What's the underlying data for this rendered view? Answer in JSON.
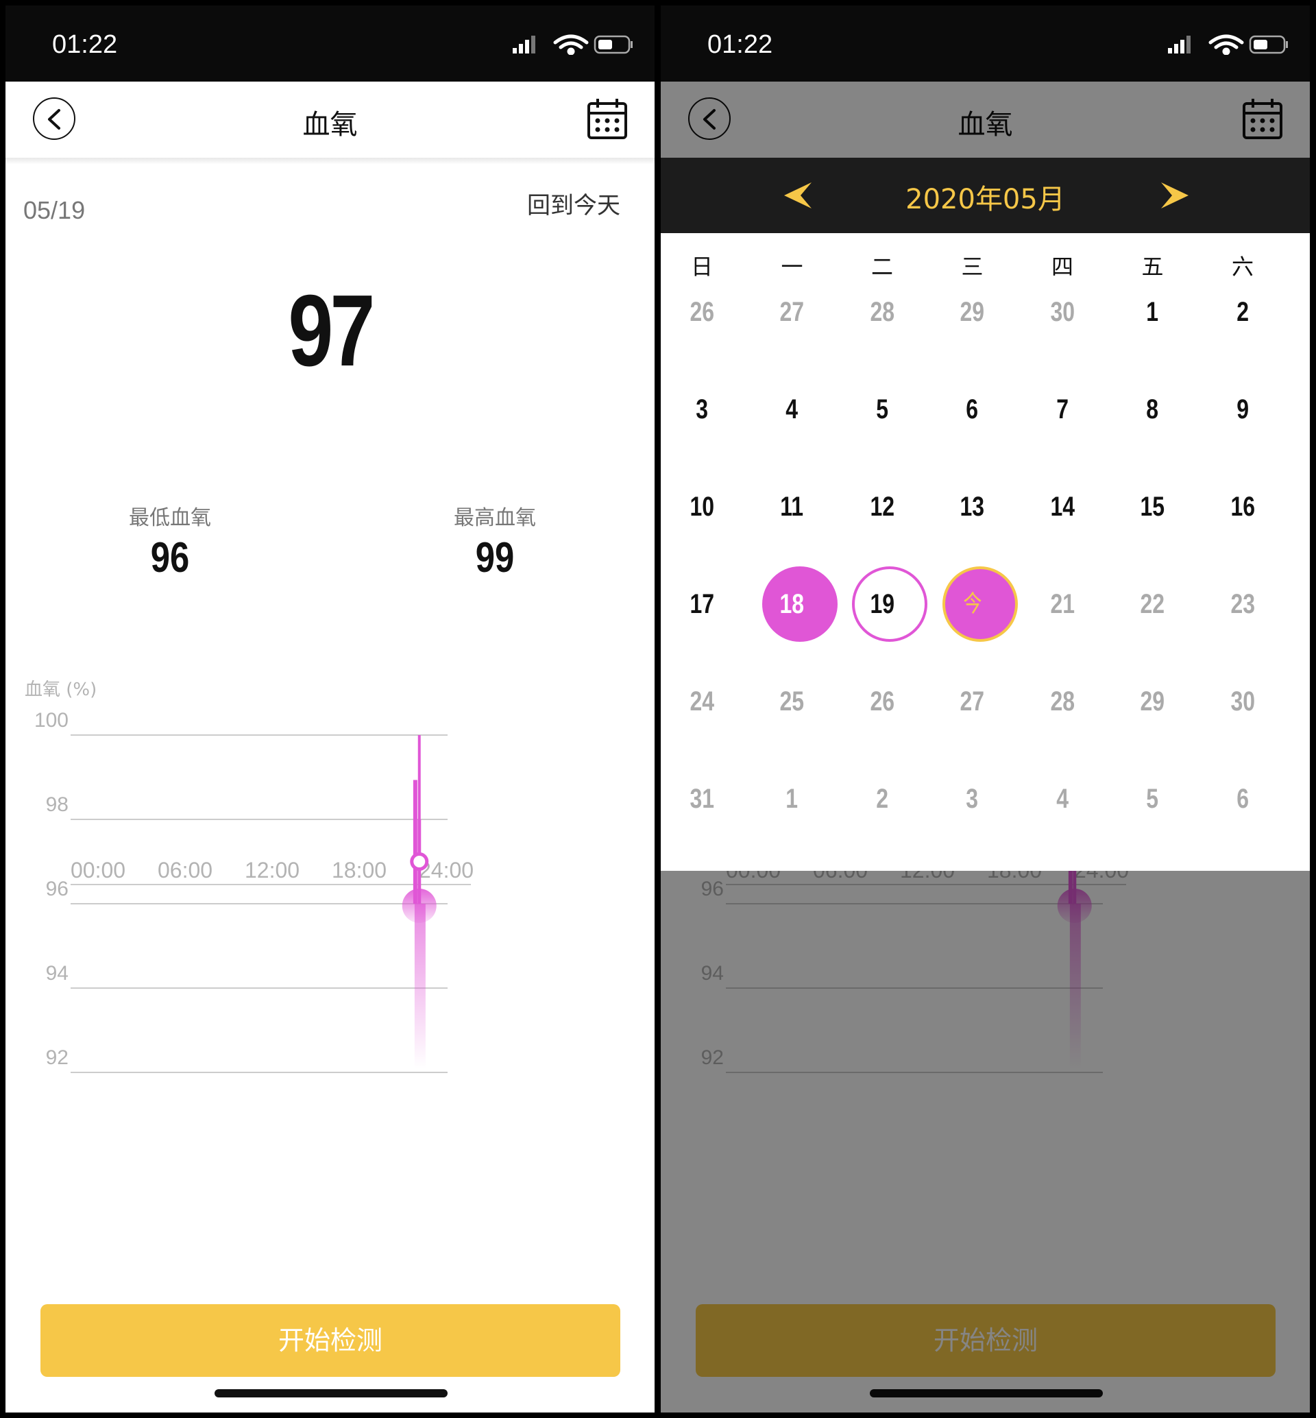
{
  "status": {
    "time": "01:22"
  },
  "nav": {
    "title": "血氧"
  },
  "summary": {
    "date": "05/19",
    "back_to_today": "回到今天",
    "current_value": "97",
    "min_label": "最低血氧",
    "min_value": "96",
    "max_label": "最高血氧",
    "max_value": "99"
  },
  "chart_data": {
    "type": "line",
    "ylabel": "血氧 (%)",
    "y_ticks": [
      "100",
      "98",
      "96",
      "94",
      "92"
    ],
    "x_ticks": [
      "00:00",
      "06:00",
      "12:00",
      "18:00",
      "24:00"
    ],
    "ylim": [
      90,
      100
    ],
    "series": [
      {
        "range_low": 96,
        "range_high": 99,
        "value": 97,
        "time_hours": 21.9
      }
    ],
    "selected_time_hours": 22.2,
    "colors": {
      "accent": "#e056d6",
      "grid": "#cccccc",
      "tick": "#b3b3b3"
    }
  },
  "action": {
    "start_label": "开始检测"
  },
  "calendar": {
    "month_title": "2020年05月",
    "weekdays": [
      "日",
      "一",
      "二",
      "三",
      "四",
      "五",
      "六"
    ],
    "weeks": [
      [
        "26",
        "27",
        "28",
        "29",
        "30",
        "1",
        "2"
      ],
      [
        "3",
        "4",
        "5",
        "6",
        "7",
        "8",
        "9"
      ],
      [
        "10",
        "11",
        "12",
        "13",
        "14",
        "15",
        "16"
      ],
      [
        "17",
        "18",
        "19",
        "今",
        "21",
        "22",
        "23"
      ],
      [
        "24",
        "25",
        "26",
        "27",
        "28",
        "29",
        "30"
      ],
      [
        "31",
        "1",
        "2",
        "3",
        "4",
        "5",
        "6"
      ]
    ],
    "selected_day": "18",
    "ringed_day": "19",
    "today_label": "今"
  },
  "colors": {
    "accent_yellow": "#f6c748",
    "accent_pink": "#e056d6"
  }
}
